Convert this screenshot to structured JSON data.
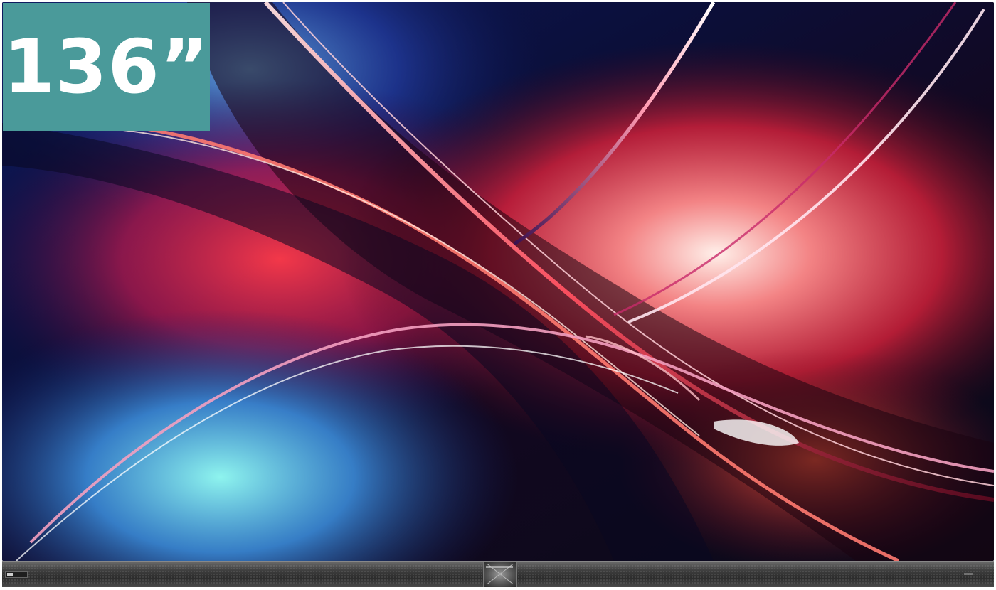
{
  "badge": {
    "size_label": "136”",
    "background_color": "#4a9a9a",
    "text_color": "#ffffff"
  },
  "screen": {
    "artwork": "abstract-crossing-ribbons",
    "palette": [
      "#0b1a5a",
      "#1c3a9a",
      "#5ad8e0",
      "#e8284a",
      "#ff6a4a",
      "#ffd8d0",
      "#0a0a12"
    ]
  },
  "soundbar": {
    "color": "#3e3e3e"
  }
}
